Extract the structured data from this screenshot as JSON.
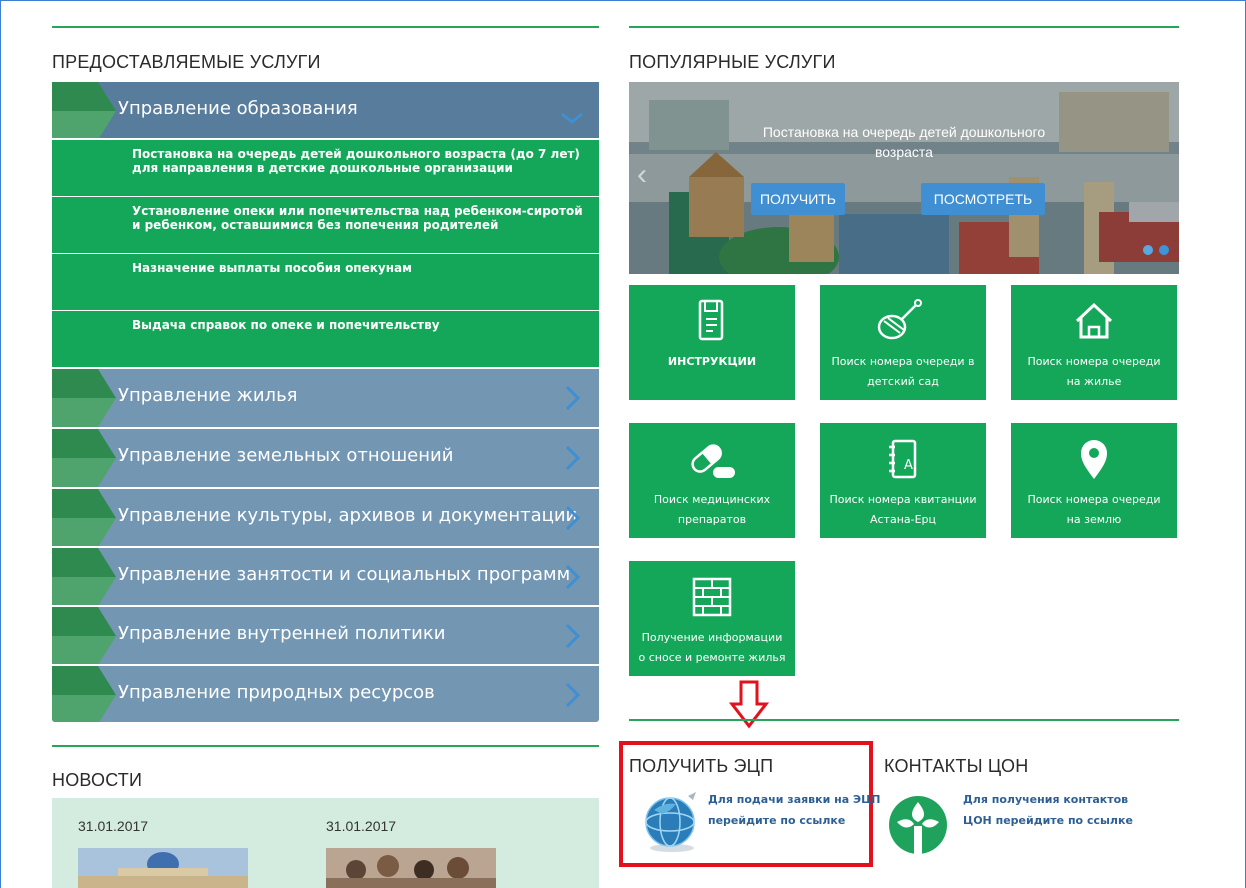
{
  "sections": {
    "services_title": "ПРЕДОСТАВЛЯЕМЫЕ УСЛУГИ",
    "popular_title": "ПОПУЛЯРНЫЕ УСЛУГИ",
    "news_title": "НОВОСТИ",
    "ecp_title": "ПОЛУЧИТЬ ЭЦП",
    "contacts_title": "КОНТАКТЫ ЦОН"
  },
  "accordion": {
    "open_group": {
      "label": "Управление образования",
      "items": [
        {
          "line1": "Постановка на очередь детей дошкольного возраста (до 7 лет)",
          "line2": "для направления в детские дошкольные организации"
        },
        {
          "line1": "Установление опеки или попечительства над ребенком-сиротой",
          "line2": "и ребенком, оставшимися без попечения родителей"
        },
        {
          "line1": "Назначение выплаты пособия опекунам",
          "line2": ""
        },
        {
          "line1": "Выдача справок по опеке и попечительству",
          "line2": ""
        }
      ]
    },
    "groups": [
      "Управление жилья",
      "Управление земельных отношений",
      "Управление культуры, архивов и документации",
      "Управление занятости и социальных программ",
      "Управление внутренней политики",
      "Управление природных ресурсов"
    ]
  },
  "slider": {
    "caption_line1": "Постановка на очередь детей дошкольного",
    "caption_line2": "возраста",
    "get_button": "ПОЛУЧИТЬ",
    "view_button": "ПОСМОТРЕТЬ"
  },
  "tiles": [
    {
      "icon": "book-icon",
      "line1": "ИНСТРУКЦИИ",
      "line2": ""
    },
    {
      "icon": "rattle-icon",
      "line1": "Поиск номера очереди в",
      "line2": "детский сад"
    },
    {
      "icon": "house-icon",
      "line1": "Поиск номера очереди",
      "line2": "на жилье"
    },
    {
      "icon": "pills-icon",
      "line1": "Поиск медицинских",
      "line2": "препаратов"
    },
    {
      "icon": "notebook-icon",
      "line1": "Поиск номера квитанции",
      "line2": "Астана-Ерц"
    },
    {
      "icon": "location-pin-icon",
      "line1": "Поиск номера очереди",
      "line2": "на землю"
    },
    {
      "icon": "brick-wall-icon",
      "line1": "Получение информации",
      "line2": "о сносе и ремонте жилья"
    }
  ],
  "ecp": {
    "line1": "Для подачи заявки на ЭЦП",
    "line2": "перейдите по ссылке"
  },
  "contacts": {
    "line1": "Для получения контактов",
    "line2": "ЦОН перейдите по ссылке"
  },
  "news": {
    "date1": "31.01.2017",
    "date2": "31.01.2017"
  },
  "colors": {
    "green": "#14a75a",
    "slate": "#7396b3",
    "highlight": "#e3111d",
    "button_blue": "#3f8fd2"
  }
}
